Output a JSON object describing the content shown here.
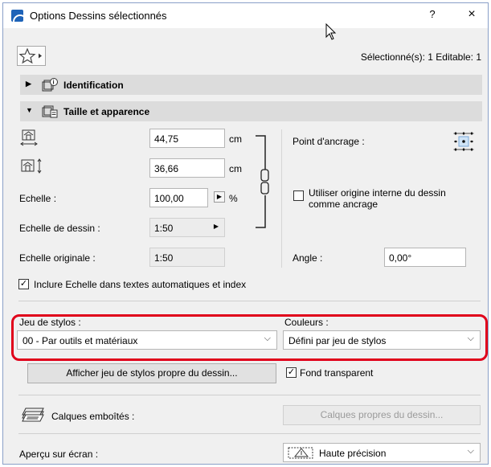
{
  "window": {
    "title": "Options Dessins sélectionnés",
    "help": "?",
    "close": "×"
  },
  "toolbar": {
    "selection_status": "Sélectionné(s): 1 Editable: 1"
  },
  "sections": {
    "identification": {
      "label": "Identification"
    },
    "size": {
      "label": "Taille et apparence"
    }
  },
  "size": {
    "width_value": "44,75",
    "width_unit": "cm",
    "height_value": "36,66",
    "height_unit": "cm",
    "scale_label": "Echelle :",
    "scale_value": "100,00",
    "scale_unit": "%",
    "drawing_scale_label": "Echelle de dessin :",
    "drawing_scale_value": "1:50",
    "original_scale_label": "Echelle originale :",
    "original_scale_value": "1:50",
    "anchor_label": "Point d'ancrage :",
    "use_origin_label_1": "Utiliser origine interne du dessin",
    "use_origin_label_2": "comme ancrage",
    "angle_label": "Angle :",
    "angle_value": "0,00°",
    "include_scale_label": "Inclure Echelle dans textes automatiques et index"
  },
  "pens": {
    "penset_label": "Jeu de stylos :",
    "penset_value": "00 - Par outils et matériaux",
    "colors_label": "Couleurs :",
    "colors_value": "Défini par jeu de stylos",
    "show_penset_button": "Afficher jeu de stylos propre du dessin...",
    "transparent_label": "Fond transparent"
  },
  "layers": {
    "label": "Calques emboîtés :",
    "button": "Calques propres du dessin..."
  },
  "preview": {
    "label": "Aperçu sur écran :",
    "value": "Haute précision"
  }
}
